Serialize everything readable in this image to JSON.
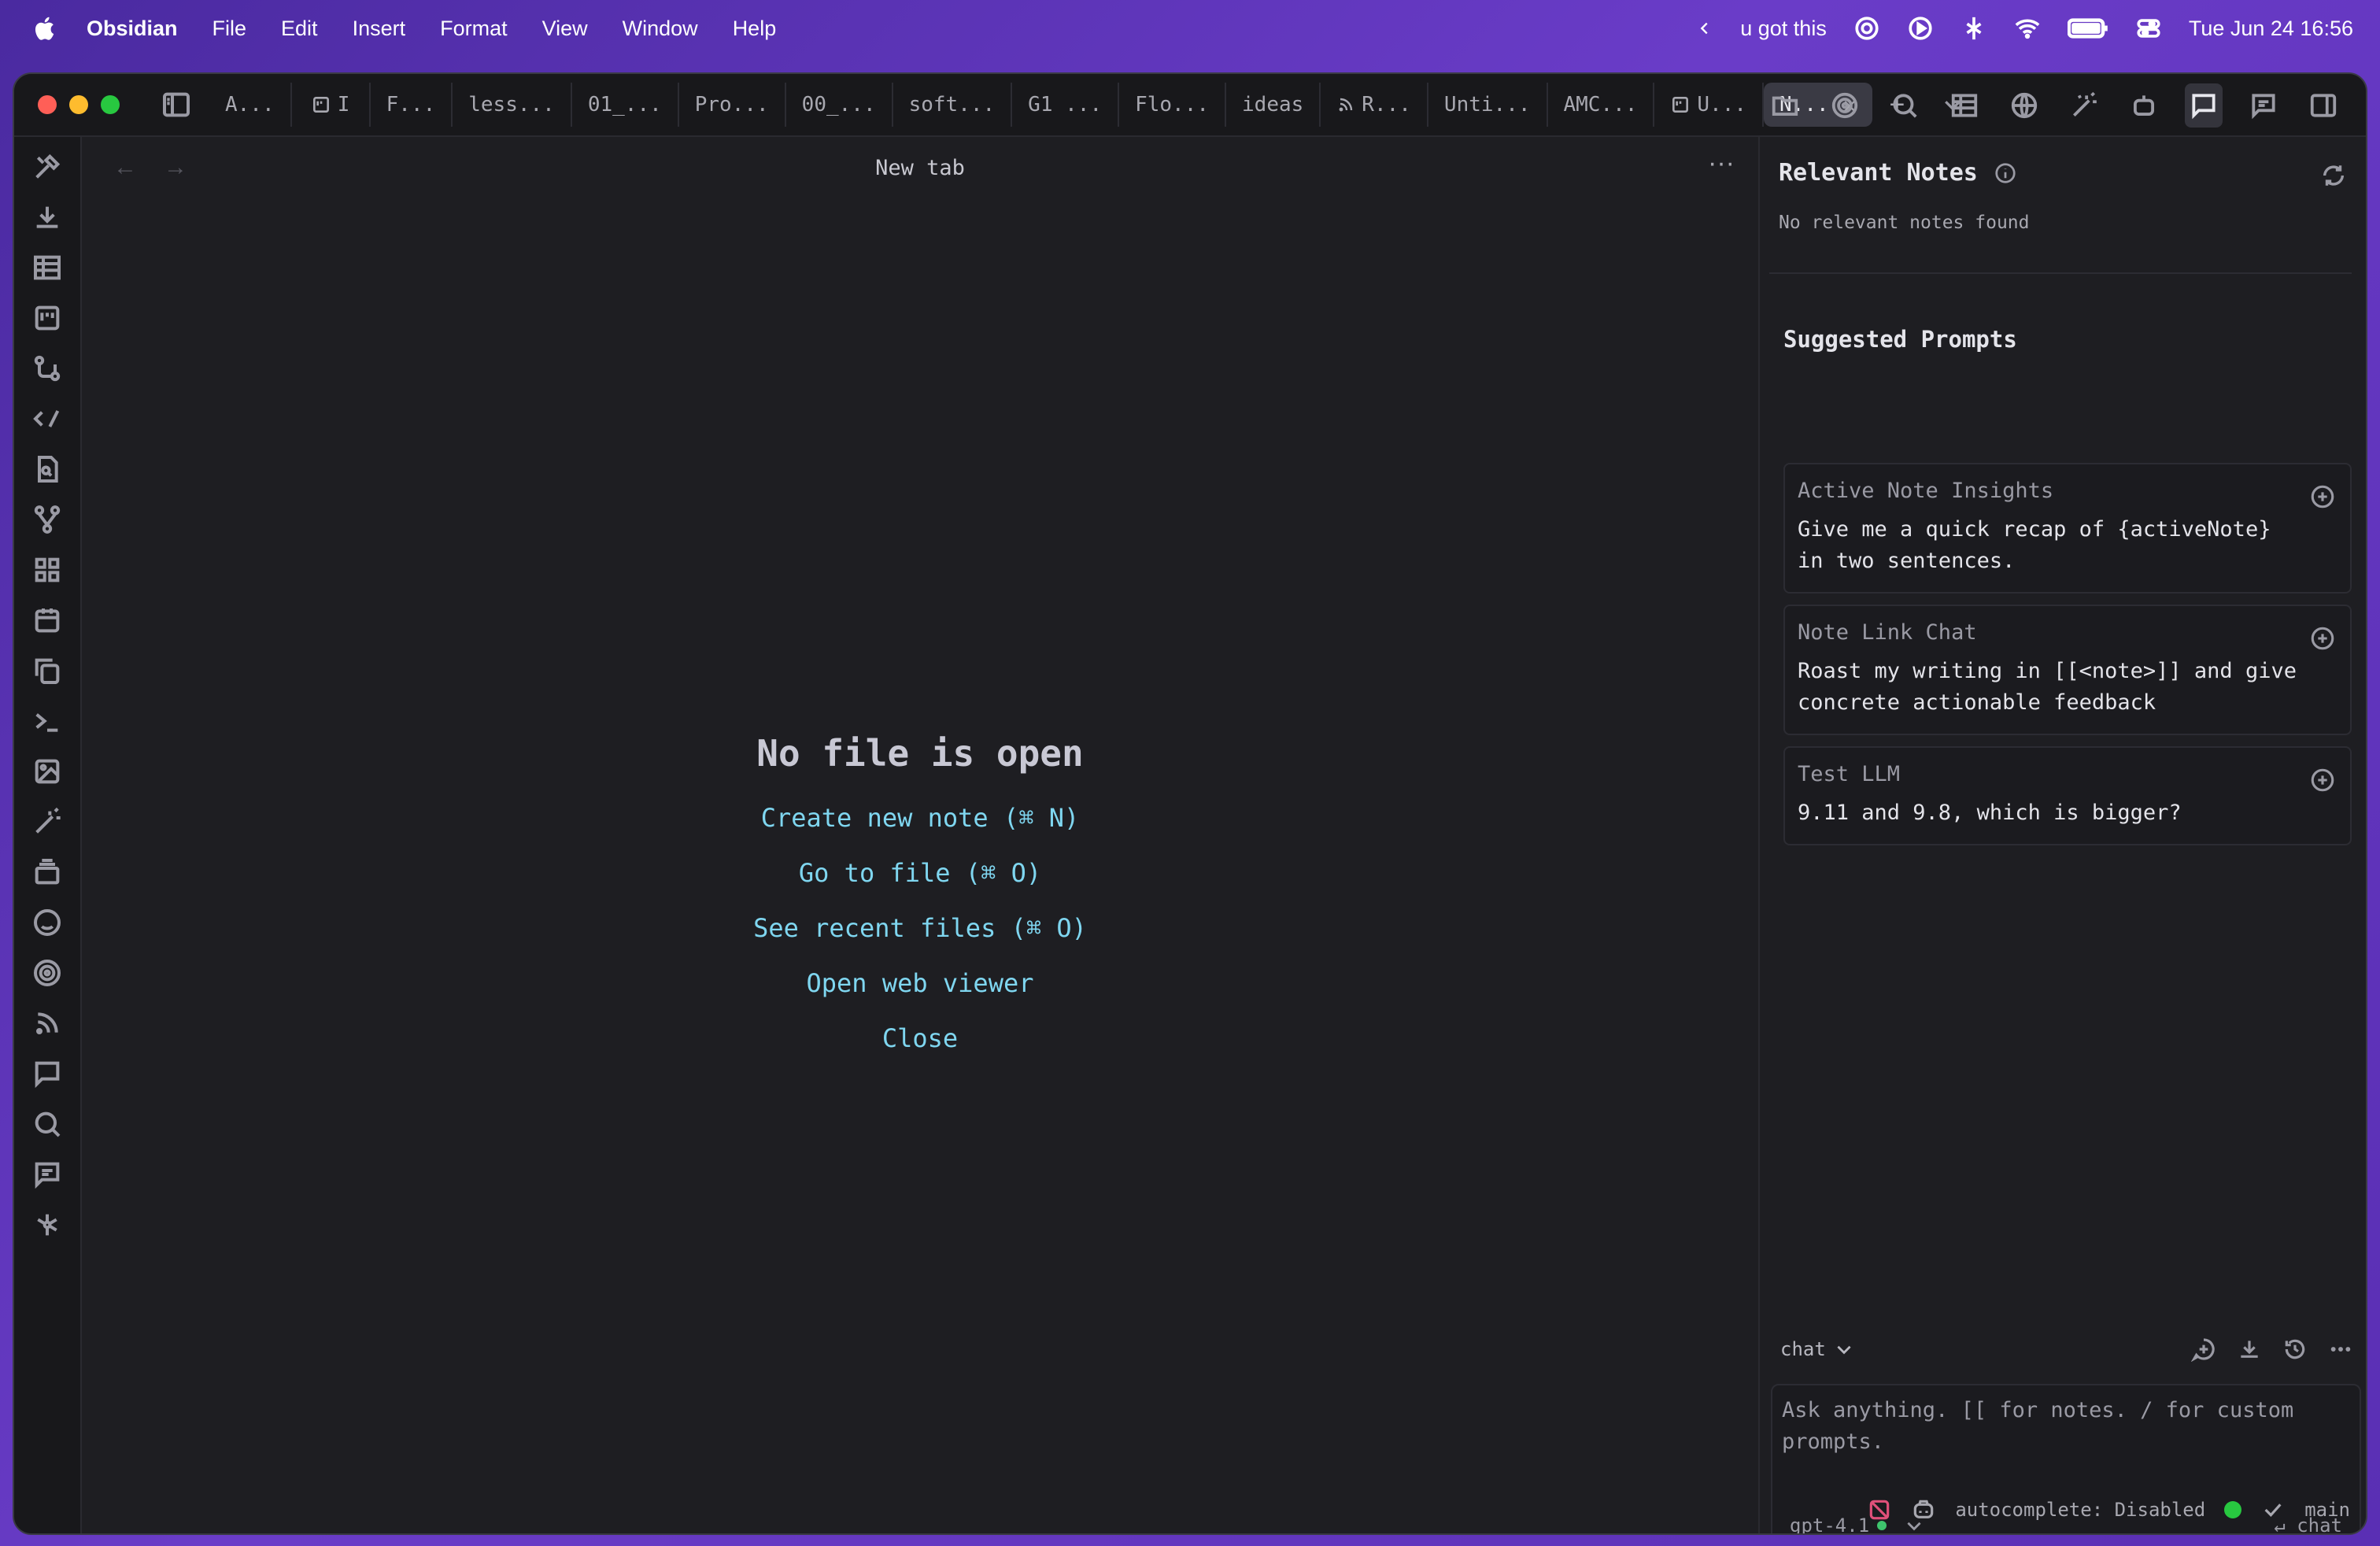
{
  "menubar": {
    "app_name": "Obsidian",
    "items": [
      "File",
      "Edit",
      "Insert",
      "Format",
      "View",
      "Window",
      "Help"
    ],
    "now_playing": "u got this",
    "datetime": "Tue Jun 24  16:56"
  },
  "tabs": [
    {
      "label": "A...",
      "icon": "none"
    },
    {
      "label": "I",
      "icon": "board-icon"
    },
    {
      "label": "F...",
      "icon": "none"
    },
    {
      "label": "less...",
      "icon": "none"
    },
    {
      "label": "01_...",
      "icon": "none"
    },
    {
      "label": "Pro...",
      "icon": "none"
    },
    {
      "label": "00_...",
      "icon": "none"
    },
    {
      "label": "soft...",
      "icon": "none"
    },
    {
      "label": "G1 ...",
      "icon": "none"
    },
    {
      "label": "Flo...",
      "icon": "none"
    },
    {
      "label": "ideas",
      "icon": "none"
    },
    {
      "label": "R...",
      "icon": "rss-icon"
    },
    {
      "label": "Unti...",
      "icon": "none"
    },
    {
      "label": "AMC...",
      "icon": "none"
    },
    {
      "label": "U...",
      "icon": "board-icon"
    },
    {
      "label": "N...",
      "icon": "none",
      "active": true
    }
  ],
  "tab_add": "+",
  "main": {
    "title": "New tab",
    "more": "···",
    "empty": {
      "heading": "No file is open",
      "actions": [
        "Create new note (⌘ N)",
        "Go to file (⌘ O)",
        "See recent files (⌘ O)",
        "Open web viewer",
        "Close"
      ]
    }
  },
  "right_panel": {
    "relevant_notes": {
      "title": "Relevant Notes",
      "empty": "No relevant notes found"
    },
    "suggested_prompts": {
      "title": "Suggested Prompts",
      "items": [
        {
          "title": "Active Note Insights",
          "body": "Give me a quick recap of {activeNote} in two sentences."
        },
        {
          "title": "Note Link Chat",
          "body": "Roast my writing in [[<note>]] and give concrete actionable feedback"
        },
        {
          "title": "Test LLM",
          "body": "9.11 and 9.8, which is bigger?"
        }
      ]
    },
    "chat": {
      "mode": "chat",
      "placeholder": "Ask anything. [[ for notes. / for custom prompts.",
      "model": "gpt-4.1",
      "send_label": "↵ chat"
    }
  },
  "status_bar": {
    "autocomplete": "autocomplete: Disabled",
    "branch": "main"
  },
  "colors": {
    "accent_link": "#7fd6f0",
    "status_green": "#28c840",
    "sync_error": "#e0507a"
  }
}
